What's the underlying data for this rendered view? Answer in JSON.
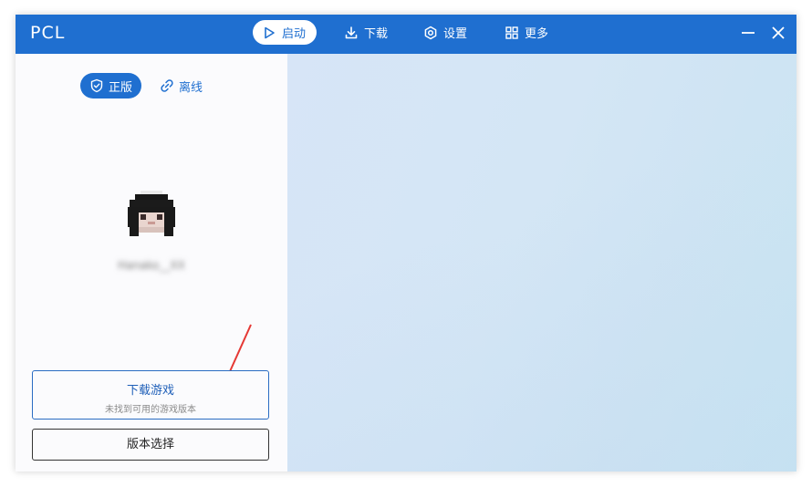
{
  "app": {
    "title": "PCL"
  },
  "nav": {
    "launch": "启动",
    "download": "下载",
    "settings": "设置",
    "more": "更多"
  },
  "mode": {
    "online": "正版",
    "offline": "离线"
  },
  "profile": {
    "username": "Hanako__XX"
  },
  "actions": {
    "download_game": "下载游戏",
    "download_game_sub": "未找到可用的游戏版本",
    "version_select": "版本选择"
  },
  "colors": {
    "accent": "#1f6fd0",
    "annotation_arrow": "#e53935"
  },
  "icons": {
    "launch": "play-icon",
    "download": "download-icon",
    "settings": "gear-icon",
    "more": "grid-icon",
    "online": "shield-check-icon",
    "offline": "link-icon",
    "minimize": "minimize-icon",
    "close": "close-icon"
  }
}
